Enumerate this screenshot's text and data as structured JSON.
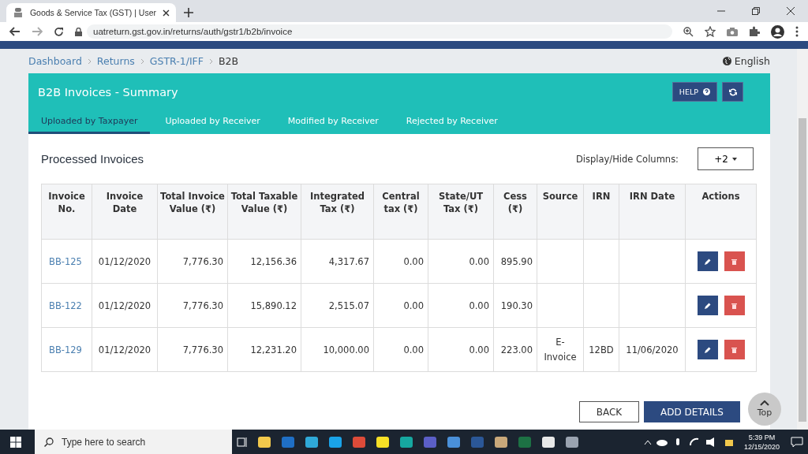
{
  "browser": {
    "tab_title": "Goods & Service Tax (GST) | User",
    "url": "uatreturn.gst.gov.in/returns/auth/gstr1/b2b/invoice"
  },
  "breadcrumb": {
    "items": [
      "Dashboard",
      "Returns",
      "GSTR-1/IFF"
    ],
    "current": "B2B"
  },
  "language": "English",
  "panel": {
    "title": "B2B Invoices - Summary",
    "help": "HELP",
    "tabs": [
      {
        "label": "Uploaded by Taxpayer",
        "selected": true
      },
      {
        "label": "Uploaded by Receiver",
        "selected": false
      },
      {
        "label": "Modified by Receiver",
        "selected": false
      },
      {
        "label": "Rejected by Receiver",
        "selected": false
      }
    ]
  },
  "section": {
    "title": "Processed Invoices",
    "columns_label": "Display/Hide Columns:",
    "columns_button": "+2"
  },
  "table": {
    "columns": [
      "Invoice No.",
      "Invoice Date",
      "Total Invoice Value (₹)",
      "Total Taxable Value (₹)",
      "Integrated Tax (₹)",
      "Central tax (₹)",
      "State/UT Tax (₹)",
      "Cess (₹)",
      "Source",
      "IRN",
      "IRN Date",
      "Actions"
    ],
    "rows": [
      {
        "cells": [
          "BB-125",
          "01/12/2020",
          "7,776.30",
          "12,156.36",
          "4,317.67",
          "0.00",
          "0.00",
          "895.90",
          "",
          "",
          ""
        ]
      },
      {
        "cells": [
          "BB-122",
          "01/12/2020",
          "7,776.30",
          "15,890.12",
          "2,515.07",
          "0.00",
          "0.00",
          "190.30",
          "",
          "",
          ""
        ]
      },
      {
        "cells": [
          "BB-129",
          "01/12/2020",
          "7,776.30",
          "12,231.20",
          "10,000.00",
          "0.00",
          "0.00",
          "223.00",
          "E-Invoice",
          "12BD",
          "11/06/2020"
        ]
      }
    ]
  },
  "buttons": {
    "back": "BACK",
    "add": "ADD DETAILS",
    "top": "Top"
  },
  "taskbar": {
    "search_placeholder": "Type here to search",
    "time": "5:39 PM",
    "date": "12/15/2020"
  }
}
